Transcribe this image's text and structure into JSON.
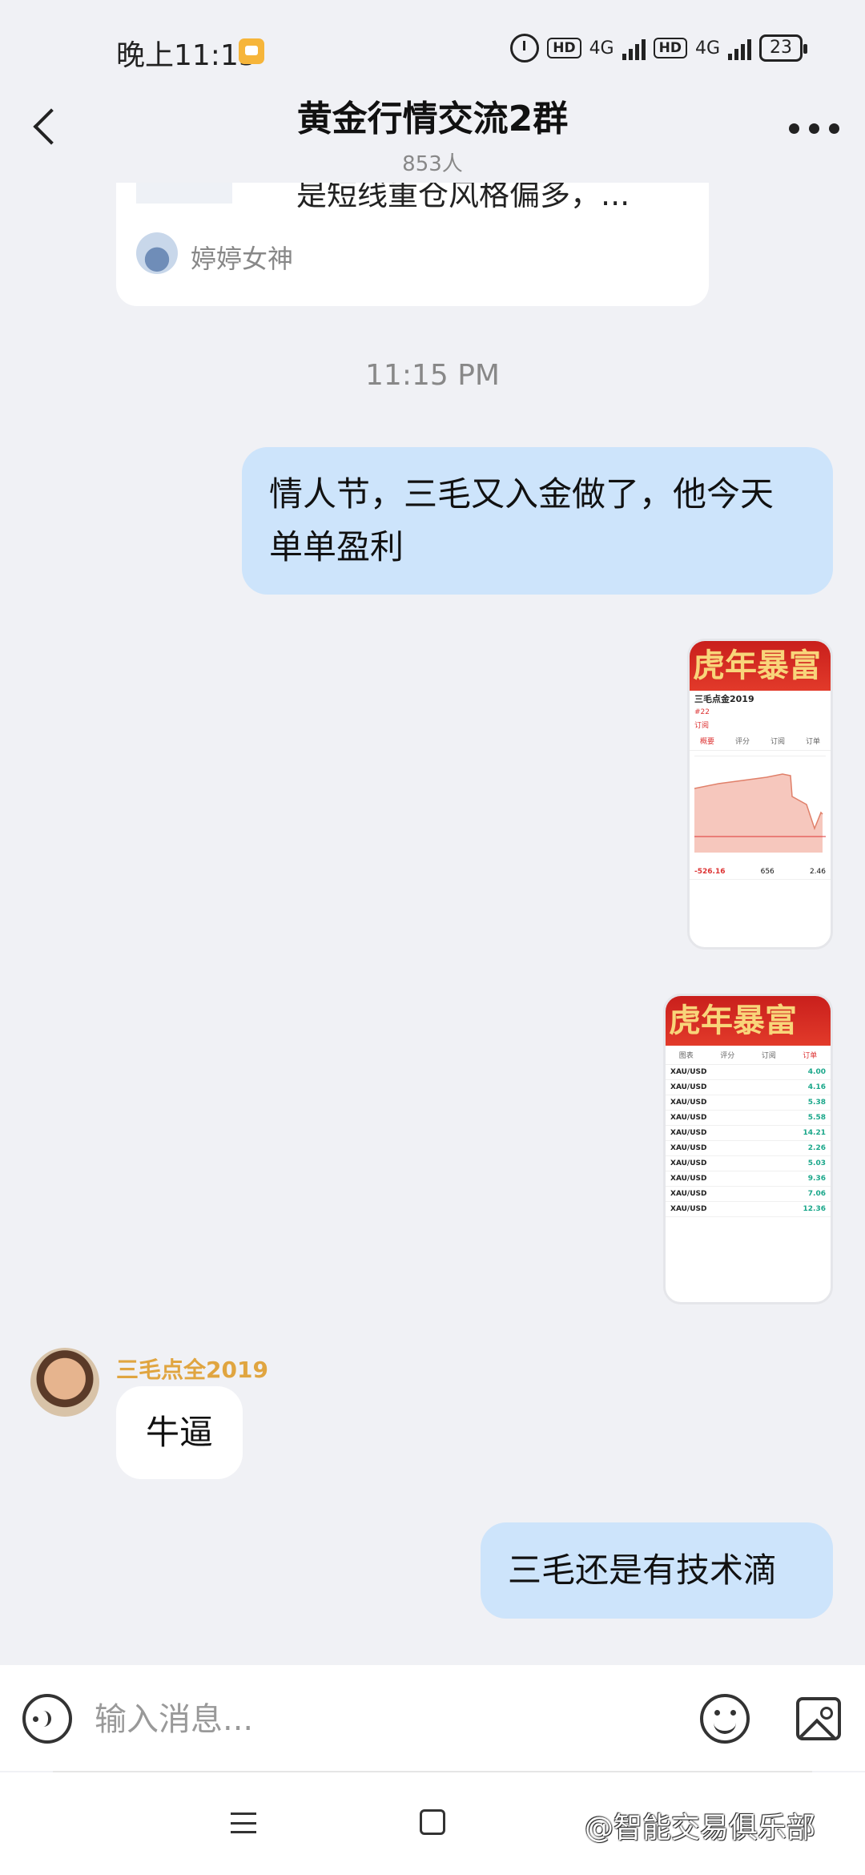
{
  "status_bar": {
    "time": "晚上11:15",
    "hd1": "HD",
    "net1": "4G",
    "hd2": "HD",
    "net2": "4G",
    "battery": "23"
  },
  "header": {
    "title": "黄金行情交流2群",
    "member_count": "853人"
  },
  "quoted_card": {
    "text": "是短线重仓风格偏多，...",
    "sender": "婷婷女神"
  },
  "timestamp": "11:15 PM",
  "messages": {
    "msg1": "情人节，三毛又入金做了，他今天单单盈利",
    "msg2_sender": "三毛点全2019",
    "msg2": "牛逼",
    "msg3": "三毛还是有技术滴"
  },
  "screenshot1": {
    "banner": "虎年暴富",
    "account": "三毛点金2019",
    "rank": "#22",
    "follow": "订阅",
    "stat1": "-526.16",
    "stat2": "656",
    "stat3": "2.46",
    "tabs": [
      "概要",
      "评分",
      "订阅",
      "订单"
    ]
  },
  "screenshot2": {
    "banner": "虎年暴富",
    "tabs": [
      "图表",
      "评分",
      "订阅",
      "订单"
    ],
    "orders": [
      {
        "pair": "XAU/USD",
        "pnl": "4.00"
      },
      {
        "pair": "XAU/USD",
        "pnl": "4.16"
      },
      {
        "pair": "XAU/USD",
        "pnl": "5.38"
      },
      {
        "pair": "XAU/USD",
        "pnl": "5.58"
      },
      {
        "pair": "XAU/USD",
        "pnl": "14.21"
      },
      {
        "pair": "XAU/USD",
        "pnl": "2.26"
      },
      {
        "pair": "XAU/USD",
        "pnl": "5.03"
      },
      {
        "pair": "XAU/USD",
        "pnl": "9.36"
      },
      {
        "pair": "XAU/USD",
        "pnl": "7.06"
      },
      {
        "pair": "XAU/USD",
        "pnl": "12.36"
      }
    ]
  },
  "input": {
    "placeholder": "输入消息..."
  },
  "watermark": "@智能交易俱乐部"
}
